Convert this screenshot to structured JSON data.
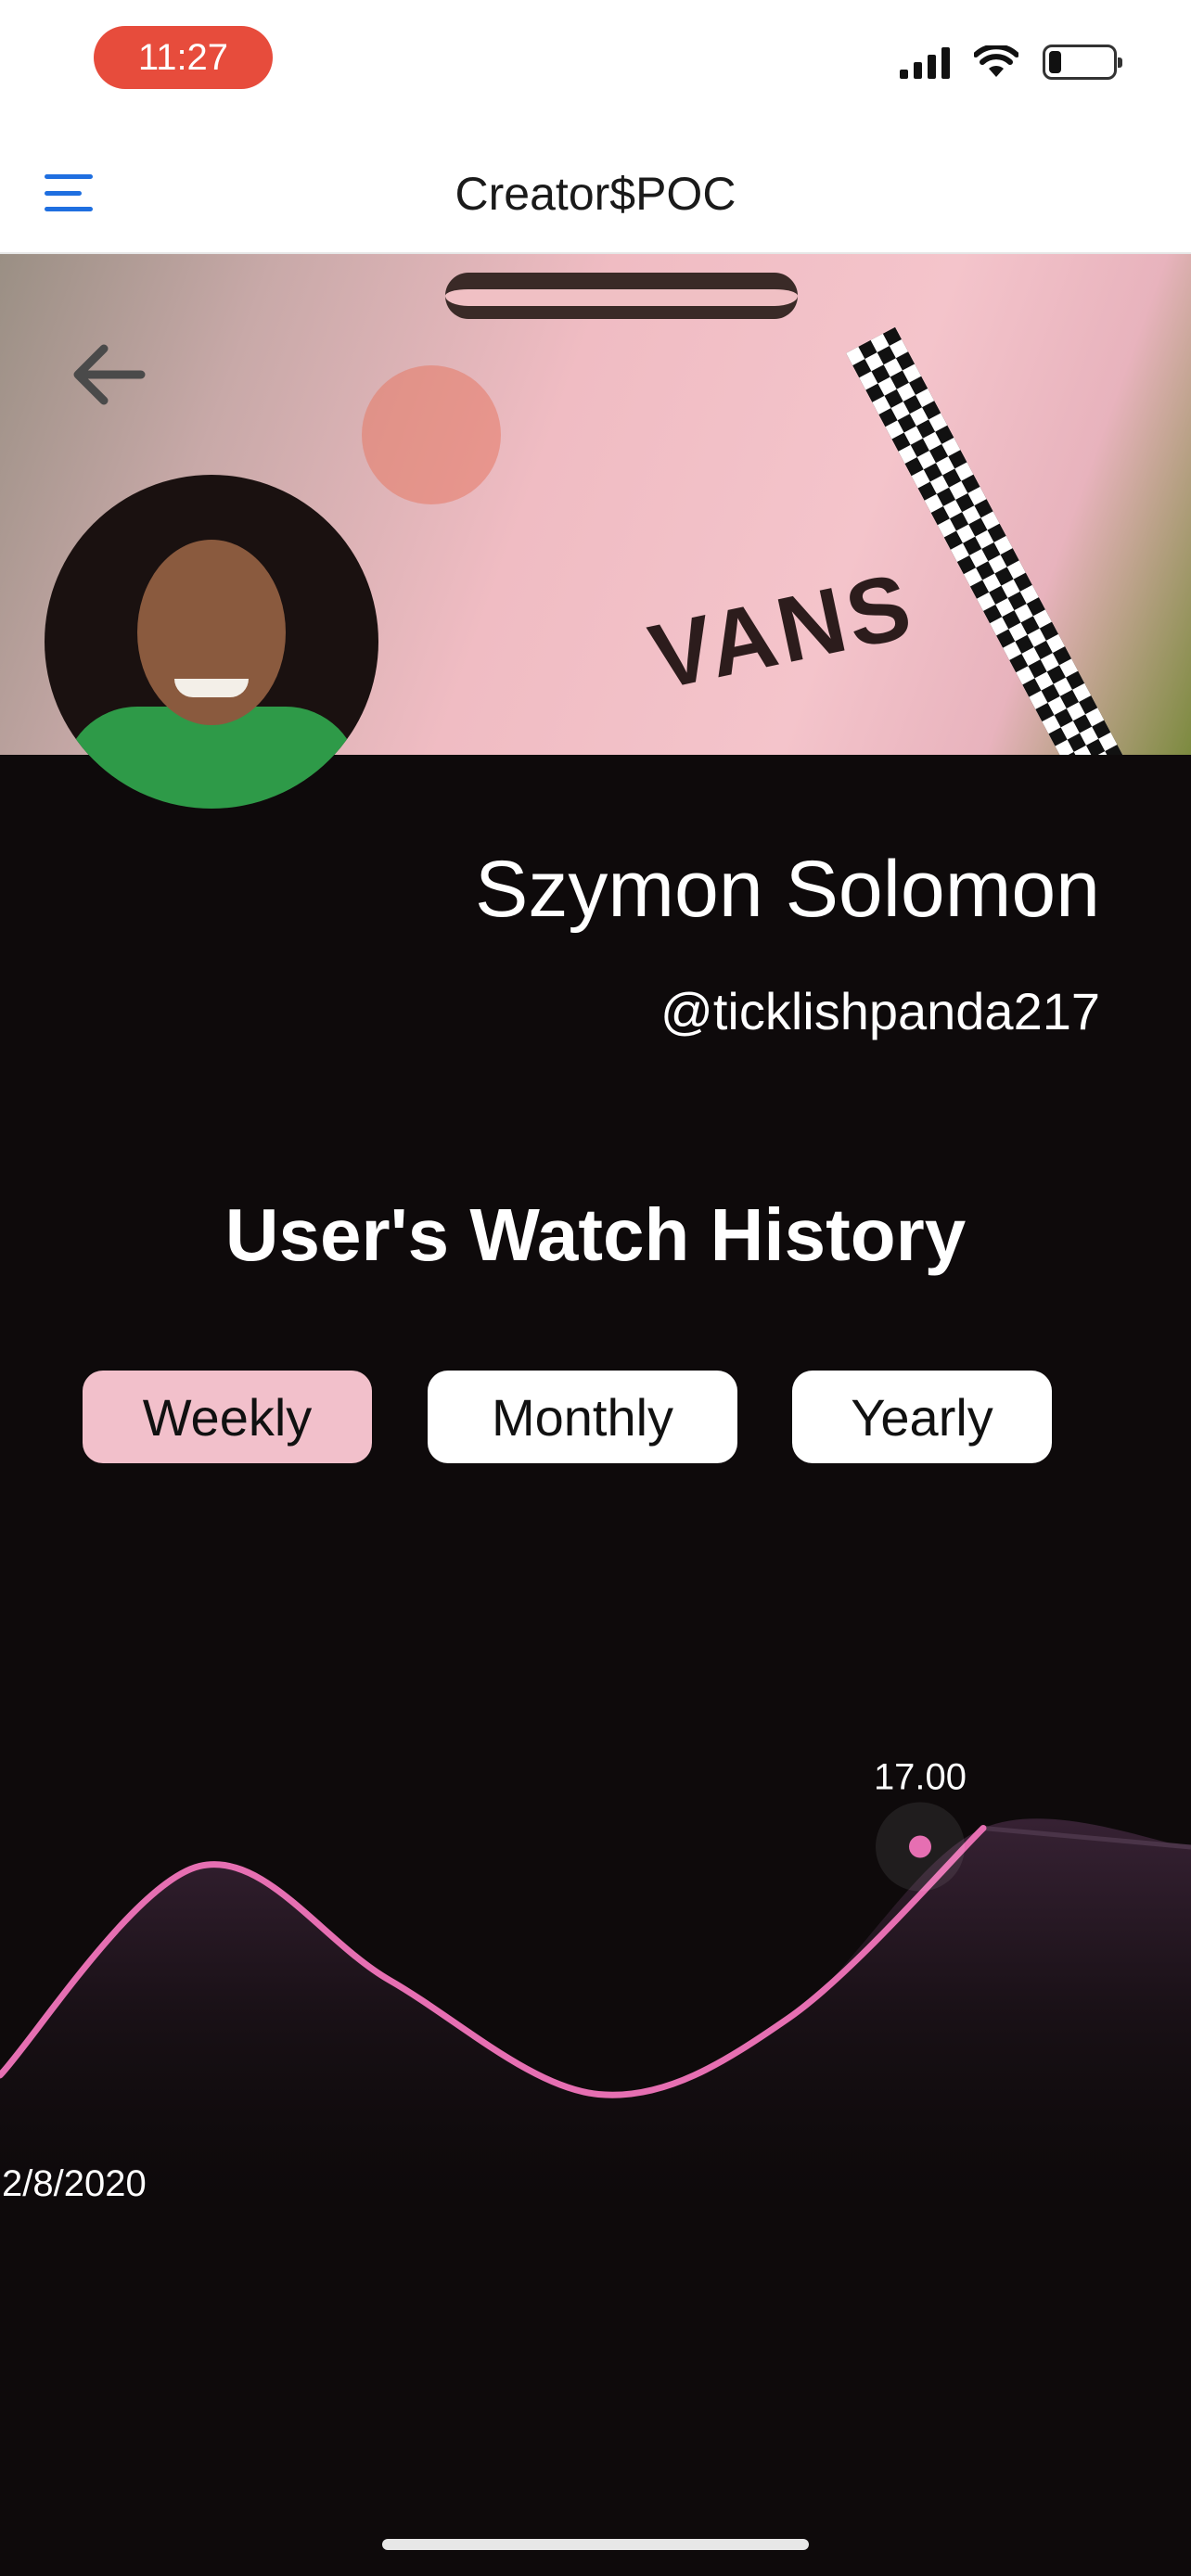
{
  "status_bar": {
    "time": "11:27",
    "battery_level": 0.2
  },
  "nav": {
    "title": "Creator$POC",
    "menu_icon": "hamburger-menu-icon"
  },
  "header": {
    "back_icon": "arrow-left-icon"
  },
  "profile": {
    "name": "Szymon Solomon",
    "handle": "@ticklishpanda217"
  },
  "watch_history": {
    "title": "User's Watch History",
    "filters": [
      {
        "label": "Weekly",
        "active": true
      },
      {
        "label": "Monthly",
        "active": false
      },
      {
        "label": "Yearly",
        "active": false
      }
    ]
  },
  "colors": {
    "accent": "#e66fb2",
    "active_filter": "#f2c0cb",
    "background": "#0e0a0b",
    "time_pill": "#e74c3c",
    "menu": "#1f6fe0"
  },
  "chart_data": {
    "type": "area",
    "x_labels": [
      "2/8/2020"
    ],
    "highlighted_value": "17.00",
    "curve": [
      {
        "x": 0,
        "y": 4
      },
      {
        "x": 1,
        "y": 15
      },
      {
        "x": 2,
        "y": 9
      },
      {
        "x": 3,
        "y": 3
      },
      {
        "x": 4,
        "y": 7
      },
      {
        "x": 5,
        "y": 17
      },
      {
        "x": 6,
        "y": 16
      }
    ]
  }
}
